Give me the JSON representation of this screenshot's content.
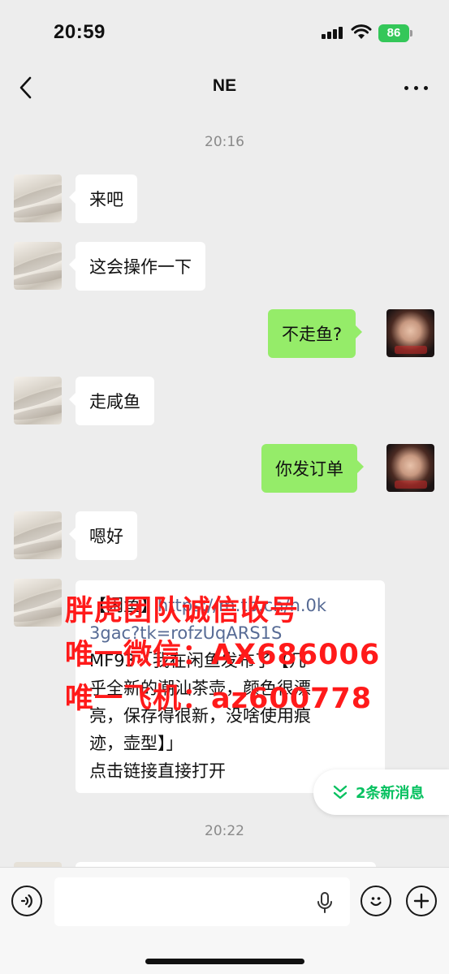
{
  "status_bar": {
    "time": "20:59",
    "battery": "86"
  },
  "header": {
    "title": "NE"
  },
  "timestamps": [
    "20:16",
    "20:22"
  ],
  "messages": [
    {
      "side": "in",
      "text": "来吧"
    },
    {
      "side": "in",
      "text": "这会操作一下"
    },
    {
      "side": "out",
      "text": "不走鱼?"
    },
    {
      "side": "in",
      "text": "走咸鱼"
    },
    {
      "side": "out",
      "text": "你发订单"
    },
    {
      "side": "in",
      "text": "嗯好"
    }
  ],
  "long_message": {
    "line1_prefix": "【闲鱼】",
    "line1_link": "https://m.tb.cn/h.0k",
    "line2": "3gac?tk=rofzUqARS1S",
    "line3": "MF93「我在闲鱼发布了【几",
    "line4": "乎全新的潮汕茶壶，颜色很漂",
    "line5": "亮，保存得很新，没啥使用痕",
    "line6": "迹，壶型】」",
    "line7": "点击链接直接打开"
  },
  "watermark": {
    "line1": "胖虎团队诚信收号",
    "line2": "唯一微信：AX686006",
    "line3": "唯一飞机：az600778"
  },
  "new_messages_pill": {
    "label": "2条新消息"
  },
  "colors": {
    "outgoing_bubble": "#95ec69",
    "incoming_bubble": "#ffffff",
    "accent": "#07c160",
    "watermark": "#ff1a1a",
    "link": "#576b95"
  },
  "icons": [
    "back-icon",
    "more-icon",
    "voice-icon",
    "mic-icon",
    "emoji-icon",
    "plus-icon",
    "chevron-down-icon"
  ]
}
